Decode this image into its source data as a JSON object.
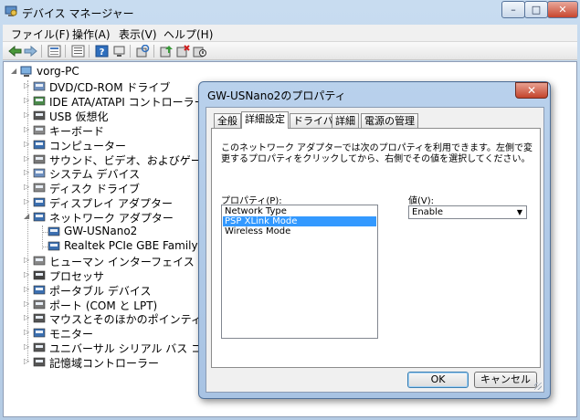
{
  "window": {
    "title": "デバイス マネージャー",
    "controls": {
      "minimize": "–",
      "maximize": "□",
      "close": "✕"
    }
  },
  "menu": {
    "items": [
      {
        "label": "ファイル(F)"
      },
      {
        "label": "操作(A)"
      },
      {
        "label": "表示(V)"
      },
      {
        "label": "ヘルプ(H)"
      }
    ]
  },
  "toolbar": {
    "icons": [
      "back-arrow-icon",
      "forward-arrow-icon",
      "view-icon",
      "properties-icon",
      "help-icon",
      "device-icon",
      "update-driver-icon",
      "uninstall-icon",
      "scan-hardware-icon"
    ]
  },
  "tree": {
    "root": "vorg-PC",
    "items": [
      {
        "label": "DVD/CD-ROM ドライブ",
        "icon": "dvd-icon"
      },
      {
        "label": "IDE ATA/ATAPI コントローラー",
        "icon": "ide-controller-icon"
      },
      {
        "label": "USB 仮想化",
        "icon": "usb-icon"
      },
      {
        "label": "キーボード",
        "icon": "keyboard-icon"
      },
      {
        "label": "コンピューター",
        "icon": "computer-icon"
      },
      {
        "label": "サウンド、ビデオ、およびゲーム コン",
        "icon": "speaker-icon"
      },
      {
        "label": "システム デバイス",
        "icon": "system-device-icon"
      },
      {
        "label": "ディスク ドライブ",
        "icon": "disk-icon"
      },
      {
        "label": "ディスプレイ アダプター",
        "icon": "display-icon"
      },
      {
        "label": "ネットワーク アダプター",
        "icon": "network-icon",
        "expanded": true
      },
      {
        "label": "GW-USNano2",
        "icon": "network-adapter-icon",
        "child": true
      },
      {
        "label": "Realtek PCIe GBE Family Contr",
        "icon": "network-adapter-icon",
        "child": true
      },
      {
        "label": "ヒューマン インターフェイス デバイ",
        "icon": "hid-icon"
      },
      {
        "label": "プロセッサ",
        "icon": "processor-icon"
      },
      {
        "label": "ポータブル デバイス",
        "icon": "portable-device-icon"
      },
      {
        "label": "ポート (COM と LPT)",
        "icon": "port-icon"
      },
      {
        "label": "マウスとそのほかのポインティング デ",
        "icon": "mouse-icon"
      },
      {
        "label": "モニター",
        "icon": "monitor-icon"
      },
      {
        "label": "ユニバーサル シリアル バス コントロ",
        "icon": "usb-controller-icon"
      },
      {
        "label": "記憶域コントローラー",
        "icon": "storage-controller-icon"
      }
    ]
  },
  "dialog": {
    "title": "GW-USNano2のプロパティ",
    "close": "✕",
    "tabs": [
      {
        "label": "全般"
      },
      {
        "label": "詳細設定",
        "active": true
      },
      {
        "label": "ドライバー"
      },
      {
        "label": "詳細"
      },
      {
        "label": "電源の管理"
      }
    ],
    "description": "このネットワーク アダプターでは次のプロパティを利用できます。左側で変更するプロパティをクリックしてから、右側でその値を選択してください。",
    "property_label": "プロパティ(P):",
    "value_label": "値(V):",
    "properties": [
      {
        "label": "Network Type"
      },
      {
        "label": "PSP XLink Mode",
        "selected": true
      },
      {
        "label": "Wireless Mode"
      }
    ],
    "value": "Enable",
    "ok": "OK",
    "cancel": "キャンセル"
  },
  "colors": {
    "selection": "#3399ff",
    "title_bar": "#c8dcf0",
    "close_button": "#c7452e"
  }
}
